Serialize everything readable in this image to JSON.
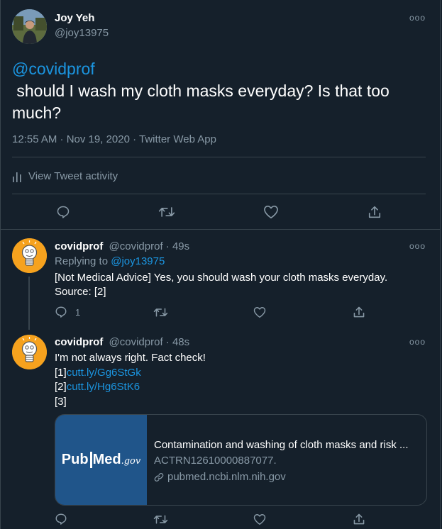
{
  "main_tweet": {
    "author_name": "Joy Yeh",
    "author_handle": "@joy13975",
    "mention": "@covidprof",
    "text": " should I wash my cloth masks everyday? Is that too much?",
    "timestamp": "12:55 AM · Nov 19, 2020 · Twitter Web App",
    "activity_label": "View Tweet activity",
    "more_icon": "more-icon"
  },
  "replies": [
    {
      "author_name": "covidprof",
      "author_handle": "@covidprof",
      "sep": "·",
      "age": "49s",
      "replying_to_label": "Replying to",
      "replying_to_handle": "@joy13975",
      "text_line1": "[Not Medical Advice] Yes, you should wash your cloth masks everyday.",
      "text_line2": "Source: [2]",
      "reply_count": "1"
    },
    {
      "author_name": "covidprof",
      "author_handle": "@covidprof",
      "sep": "·",
      "age": "48s",
      "text_line1": "I'm not always right. Fact check!",
      "ref1_prefix": "[1]",
      "ref1_link": "cutt.ly/Gg6StGk",
      "ref2_prefix": "[2]",
      "ref2_link": "cutt.ly/Hg6StK6",
      "ref3_prefix": "[3]",
      "card": {
        "logo_pub": "Pub",
        "logo_med": "Med",
        "logo_gov": ".gov",
        "title": "Contamination and washing of cloth masks and risk ...",
        "description": "ACTRN12610000887077.",
        "domain": "pubmed.ncbi.nlm.nih.gov"
      }
    }
  ],
  "colors": {
    "background": "#15202b",
    "accent": "#1b95e0",
    "muted": "#8899a6",
    "border": "#38444d",
    "pubmed_blue": "#20558a"
  }
}
